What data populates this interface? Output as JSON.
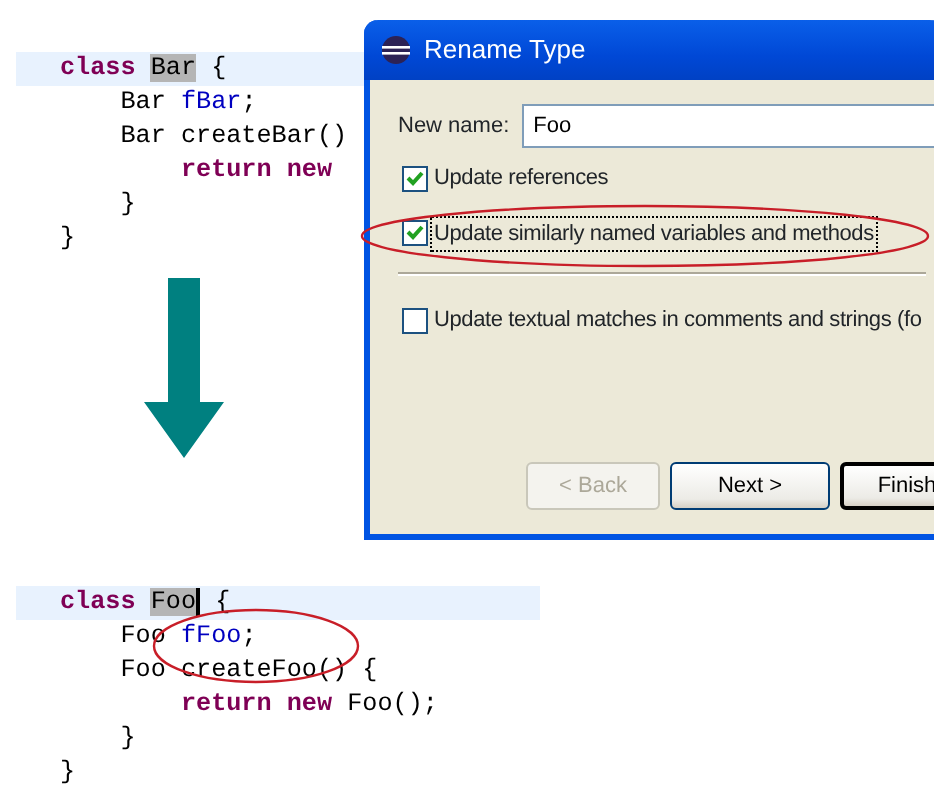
{
  "top_code": {
    "lines": [
      {
        "current": true,
        "tokens": [
          {
            "text": "class ",
            "kind": "keyword"
          },
          {
            "text": "Bar",
            "kind": "selected",
            "caret": false
          },
          {
            "text": " {",
            "kind": "plain"
          }
        ],
        "children": [
          {
            "current": false,
            "tokens": [
              {
                "text": "Bar ",
                "kind": "plain"
              },
              {
                "text": "fBar",
                "kind": "field"
              },
              {
                "text": ";",
                "kind": "plain"
              }
            ]
          },
          {
            "current": false,
            "tokens": [
              {
                "text": "Bar createBar()",
                "kind": "plain"
              }
            ],
            "children": [
              {
                "current": false,
                "tokens": [
                  {
                    "text": "return new",
                    "kind": "keyword"
                  }
                ]
              }
            ]
          },
          {
            "current": false,
            "tokens": [
              {
                "text": "}",
                "kind": "plain"
              }
            ]
          }
        ]
      },
      {
        "current": false,
        "tokens": [
          {
            "text": "}",
            "kind": "plain"
          }
        ]
      }
    ]
  },
  "dialog": {
    "title": "Rename Type",
    "new_name": {
      "label": "New name:",
      "value": "Foo"
    },
    "options": [
      {
        "label": "Update references",
        "checked": true,
        "focused": false,
        "circled": false
      },
      {
        "label": "Update similarly named variables and methods",
        "checked": true,
        "focused": true,
        "circled": true
      },
      {
        "label": "Update textual matches in comments and strings (fo",
        "checked": false,
        "focused": false,
        "circled": false
      }
    ],
    "buttons": [
      {
        "label": "< Back",
        "disabled": true,
        "default": false
      },
      {
        "label": "Next >",
        "disabled": false,
        "default": false
      },
      {
        "label": "Finish",
        "disabled": false,
        "default": true
      }
    ]
  },
  "bottom_code": {
    "circled": true,
    "lines": [
      {
        "current": true,
        "tokens": [
          {
            "text": "class ",
            "kind": "keyword"
          },
          {
            "text": "Foo",
            "kind": "selected",
            "caret": true
          },
          {
            "text": " {",
            "kind": "plain"
          }
        ],
        "children": [
          {
            "current": false,
            "tokens": [
              {
                "text": "Foo ",
                "kind": "plain"
              },
              {
                "text": "fFoo",
                "kind": "field"
              },
              {
                "text": ";",
                "kind": "plain"
              }
            ]
          },
          {
            "current": false,
            "tokens": [
              {
                "text": "Foo createFoo() {",
                "kind": "plain"
              }
            ],
            "children": [
              {
                "current": false,
                "tokens": [
                  {
                    "text": "return new",
                    "kind": "keyword"
                  },
                  {
                    "text": " Foo();",
                    "kind": "plain"
                  }
                ]
              }
            ]
          },
          {
            "current": false,
            "tokens": [
              {
                "text": "}",
                "kind": "plain"
              }
            ]
          }
        ]
      },
      {
        "current": false,
        "tokens": [
          {
            "text": "}",
            "kind": "plain"
          }
        ]
      }
    ]
  }
}
